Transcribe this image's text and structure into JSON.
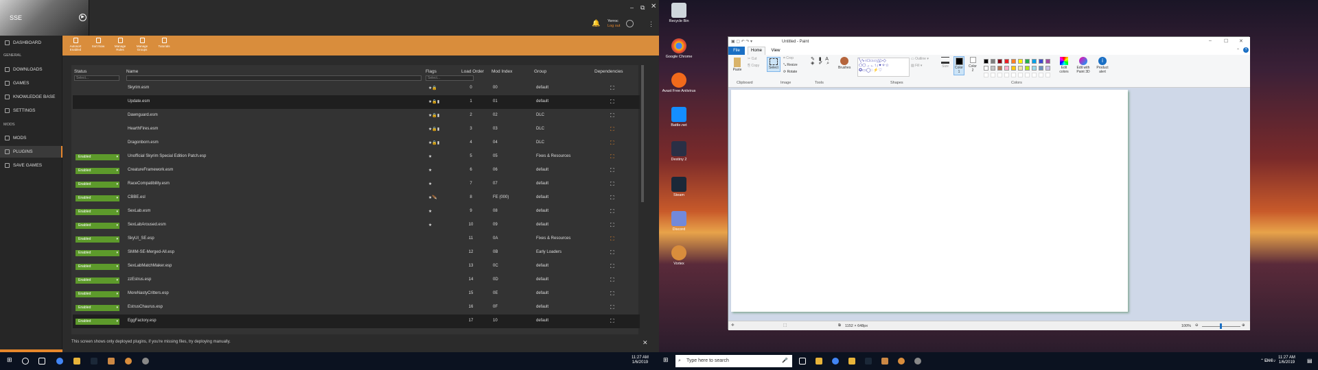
{
  "vortex": {
    "game_short": "SSE",
    "nav": {
      "dashboard": "DASHBOARD",
      "general": "GENERAL",
      "downloads": "DOWNLOADS",
      "games": "GAMES",
      "knowledge": "KNOWLEDGE BASE",
      "settings": "SETTINGS",
      "mods_sec": "MODS",
      "mods": "MODS",
      "plugins": "PLUGINS",
      "saves": "SAVE GAMES"
    },
    "toolbar": {
      "autosort": "Autosort Enabled",
      "sortnow": "Sort Now",
      "rules": "Manage Rules",
      "groups": "Manage Groups",
      "tutorials": "Tutorials"
    },
    "user": {
      "name": "Yerroc",
      "logout": "Log out"
    },
    "table": {
      "headers": {
        "status": "Status",
        "name": "Name",
        "flags": "Flags",
        "load_order": "Load Order",
        "mod_index": "Mod Index",
        "group": "Group",
        "deps": "Dependencies"
      },
      "filter_placeholder": "Select...",
      "rows": [
        {
          "status": "",
          "name": "Skyrim.esm",
          "flags": "★🔒",
          "lo": "0",
          "mi": "00",
          "group": "default",
          "warn": false
        },
        {
          "status": "",
          "name": "Update.esm",
          "flags": "★🔒▮",
          "lo": "1",
          "mi": "01",
          "group": "default",
          "warn": false
        },
        {
          "status": "",
          "name": "Dawnguard.esm",
          "flags": "★🔒▮",
          "lo": "2",
          "mi": "02",
          "group": "DLC",
          "warn": false
        },
        {
          "status": "",
          "name": "HearthFires.esm",
          "flags": "★🔒▮",
          "lo": "3",
          "mi": "03",
          "group": "DLC",
          "warn": true
        },
        {
          "status": "",
          "name": "Dragonborn.esm",
          "flags": "★🔒▮",
          "lo": "4",
          "mi": "04",
          "group": "DLC",
          "warn": true
        },
        {
          "status": "Enabled",
          "name": "Unofficial Skyrim Special Edition Patch.esp",
          "flags": "★",
          "lo": "5",
          "mi": "05",
          "group": "Fixes & Resources",
          "warn": true
        },
        {
          "status": "Enabled",
          "name": "CreatureFramework.esm",
          "flags": "★",
          "lo": "6",
          "mi": "06",
          "group": "default",
          "warn": false
        },
        {
          "status": "Enabled",
          "name": "RaceCompatibility.esm",
          "flags": "★",
          "lo": "7",
          "mi": "07",
          "group": "default",
          "warn": false
        },
        {
          "status": "Enabled",
          "name": "CBBE.esl",
          "flags": "★🪶",
          "lo": "8",
          "mi": "FE (000)",
          "group": "default",
          "warn": false
        },
        {
          "status": "Enabled",
          "name": "SexLab.esm",
          "flags": "★",
          "lo": "9",
          "mi": "08",
          "group": "default",
          "warn": false
        },
        {
          "status": "Enabled",
          "name": "SexLabAroused.esm",
          "flags": "★",
          "lo": "10",
          "mi": "09",
          "group": "default",
          "warn": false
        },
        {
          "status": "Enabled",
          "name": "SkyUI_SE.esp",
          "flags": "",
          "lo": "11",
          "mi": "0A",
          "group": "Fixes & Resources",
          "warn": true
        },
        {
          "status": "Enabled",
          "name": "SMIM-SE-Merged-All.esp",
          "flags": "",
          "lo": "12",
          "mi": "0B",
          "group": "Early Loaders",
          "warn": false
        },
        {
          "status": "Enabled",
          "name": "SexLabMatchMaker.esp",
          "flags": "",
          "lo": "13",
          "mi": "0C",
          "group": "default",
          "warn": false
        },
        {
          "status": "Enabled",
          "name": "zzEstrus.esp",
          "flags": "",
          "lo": "14",
          "mi": "0D",
          "group": "default",
          "warn": false
        },
        {
          "status": "Enabled",
          "name": "MoreNastyCritters.esp",
          "flags": "",
          "lo": "15",
          "mi": "0E",
          "group": "default",
          "warn": false
        },
        {
          "status": "Enabled",
          "name": "EstrusChaurus.esp",
          "flags": "",
          "lo": "16",
          "mi": "0F",
          "group": "default",
          "warn": false
        },
        {
          "status": "Enabled",
          "name": "EggFactory.esp",
          "flags": "",
          "lo": "17",
          "mi": "10",
          "group": "default",
          "warn": false
        }
      ]
    },
    "footer": "This screen shows only deployed plugins, if you're missing files, try deploying manually."
  },
  "desktop": {
    "icons": [
      "Recycle Bin",
      "Google Chrome",
      "Avast Free Antivirus",
      "Battle.net",
      "Destiny 2",
      "Steam",
      "Discord",
      "Vortex"
    ]
  },
  "paint": {
    "title": "Untitled - Paint",
    "tabs": {
      "file": "File",
      "home": "Home",
      "view": "View"
    },
    "groups": {
      "clipboard": "Clipboard",
      "image": "Image",
      "tools": "Tools",
      "shapes": "Shapes",
      "colors": "Colors"
    },
    "buttons": {
      "paste": "Paste",
      "cut": "Cut",
      "copy": "Copy",
      "select": "Select",
      "crop": "Crop",
      "resize": "Resize",
      "rotate": "Rotate",
      "brushes": "Brushes",
      "outline": "Outline",
      "fill": "Fill",
      "size": "Size",
      "color1": "Color 1",
      "color2": "Color 2",
      "edit_colors": "Edit colors",
      "edit_paint3d": "Edit with Paint 3D",
      "product_alert": "Product alert"
    },
    "status": {
      "canvas_size": "1152 × 648px",
      "zoom": "100%"
    },
    "palette": [
      "#000000",
      "#7f7f7f",
      "#880015",
      "#ed1c24",
      "#ff7f27",
      "#fff200",
      "#22b14c",
      "#00a2e8",
      "#3f48cc",
      "#a349a4",
      "#ffffff",
      "#c3c3c3",
      "#b97a57",
      "#ffaec9",
      "#ffc90e",
      "#efe4b0",
      "#b5e61d",
      "#99d9ea",
      "#7092be",
      "#c8bfe7"
    ]
  },
  "taskbar": {
    "left_clock": {
      "time": "11:27 AM",
      "date": "1/6/2019"
    },
    "search_placeholder": "Type here to search",
    "lang": "ENG",
    "right_clock": {
      "time": "11:27 AM",
      "date": "1/6/2019"
    }
  }
}
